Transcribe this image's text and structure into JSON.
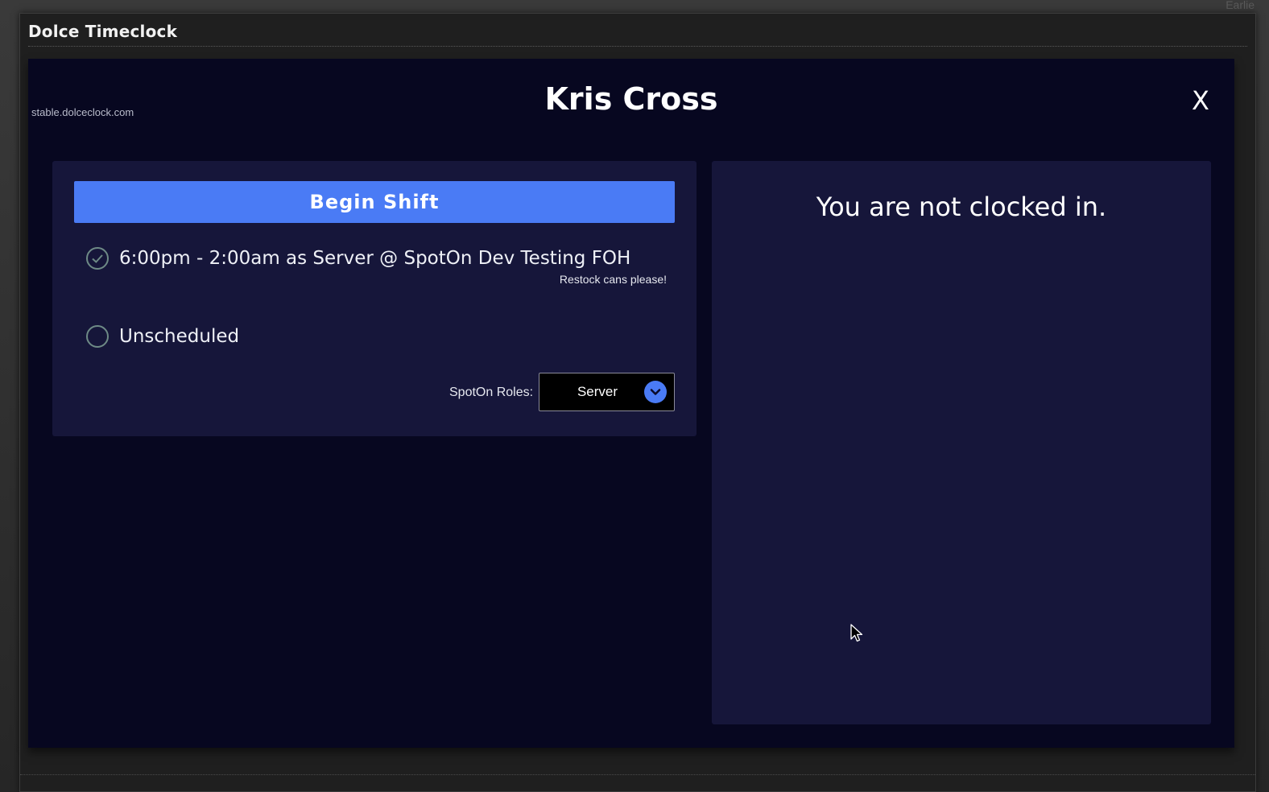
{
  "window": {
    "title": "Dolce Timeclock",
    "corner_text": "Earlie"
  },
  "app": {
    "host": "stable.dolceclock.com",
    "user_name": "Kris Cross",
    "close_label": "X"
  },
  "shift_panel": {
    "begin_label": "Begin Shift",
    "options": [
      {
        "label": "6:00pm - 2:00am as Server @ SpotOn Dev Testing FOH",
        "note": "Restock cans please!",
        "selected": true
      },
      {
        "label": "Unscheduled",
        "selected": false
      }
    ],
    "roles_label": "SpotOn Roles:",
    "roles_value": "Server"
  },
  "status_panel": {
    "message": "You are not clocked in."
  },
  "colors": {
    "accent": "#4a7bf5",
    "background": "#070720",
    "panel": "#16163a"
  },
  "icons": {
    "close": "close-icon",
    "check": "check-circle-icon",
    "radio": "radio-empty-icon",
    "dropdown": "chevron-down-icon",
    "cursor": "mouse-cursor-icon"
  }
}
